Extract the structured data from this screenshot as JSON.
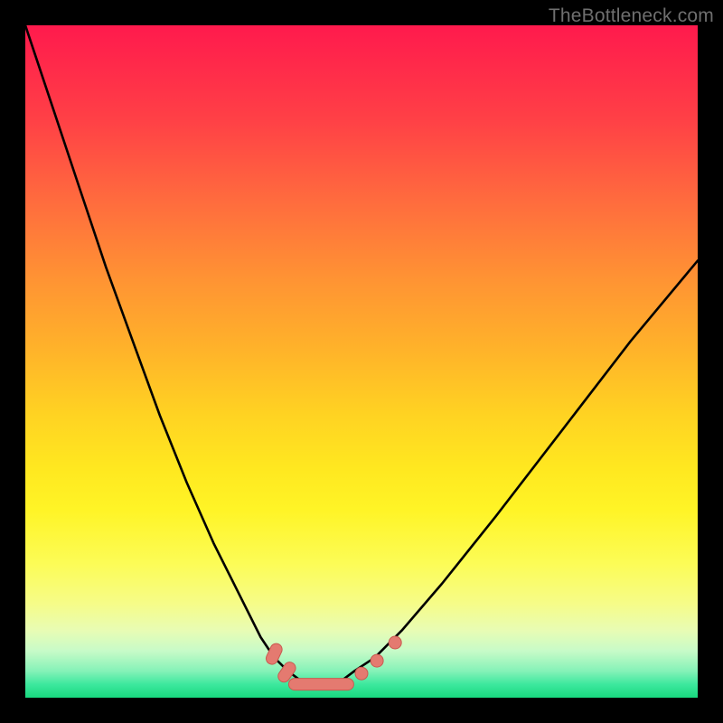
{
  "watermark": "TheBottleneck.com",
  "colors": {
    "frame": "#000000",
    "curve_stroke": "#000000",
    "marker_fill": "#e47a70",
    "marker_stroke": "#c95a50"
  },
  "chart_data": {
    "type": "line",
    "title": "",
    "xlabel": "",
    "ylabel": "",
    "xlim": [
      0,
      100
    ],
    "ylim": [
      0,
      100
    ],
    "grid": false,
    "legend": false,
    "note": "No axis ticks or numeric labels are rendered; values estimated from pixel positions on a 0-100 normalized scale. y is plotted with 0 at bottom (lower = better match). Curve is a V-shaped bottleneck profile with minimum near x≈44.",
    "series": [
      {
        "name": "bottleneck-curve",
        "x": [
          0,
          4,
          8,
          12,
          16,
          20,
          24,
          28,
          32,
          35,
          37,
          39,
          41,
          43,
          45,
          47,
          49,
          52,
          56,
          62,
          70,
          80,
          90,
          100
        ],
        "y": [
          100,
          88,
          76,
          64,
          53,
          42,
          32,
          23,
          15,
          9,
          6,
          4,
          2.5,
          2,
          2,
          2.5,
          4,
          6,
          10,
          17,
          27,
          40,
          53,
          65
        ]
      }
    ],
    "markers": {
      "name": "highlight-dots",
      "note": "Salmon capsule/dots near curve minimum",
      "points": [
        {
          "x": 37.0,
          "y": 6.5,
          "shape": "capsule",
          "angle": -65
        },
        {
          "x": 38.9,
          "y": 3.8,
          "shape": "capsule",
          "angle": -55
        },
        {
          "x": 44.0,
          "y": 2.0,
          "shape": "capsule",
          "angle": 0,
          "long": true
        },
        {
          "x": 50.0,
          "y": 3.6,
          "shape": "dot"
        },
        {
          "x": 52.3,
          "y": 5.5,
          "shape": "dot"
        },
        {
          "x": 55.0,
          "y": 8.2,
          "shape": "dot"
        }
      ]
    }
  }
}
